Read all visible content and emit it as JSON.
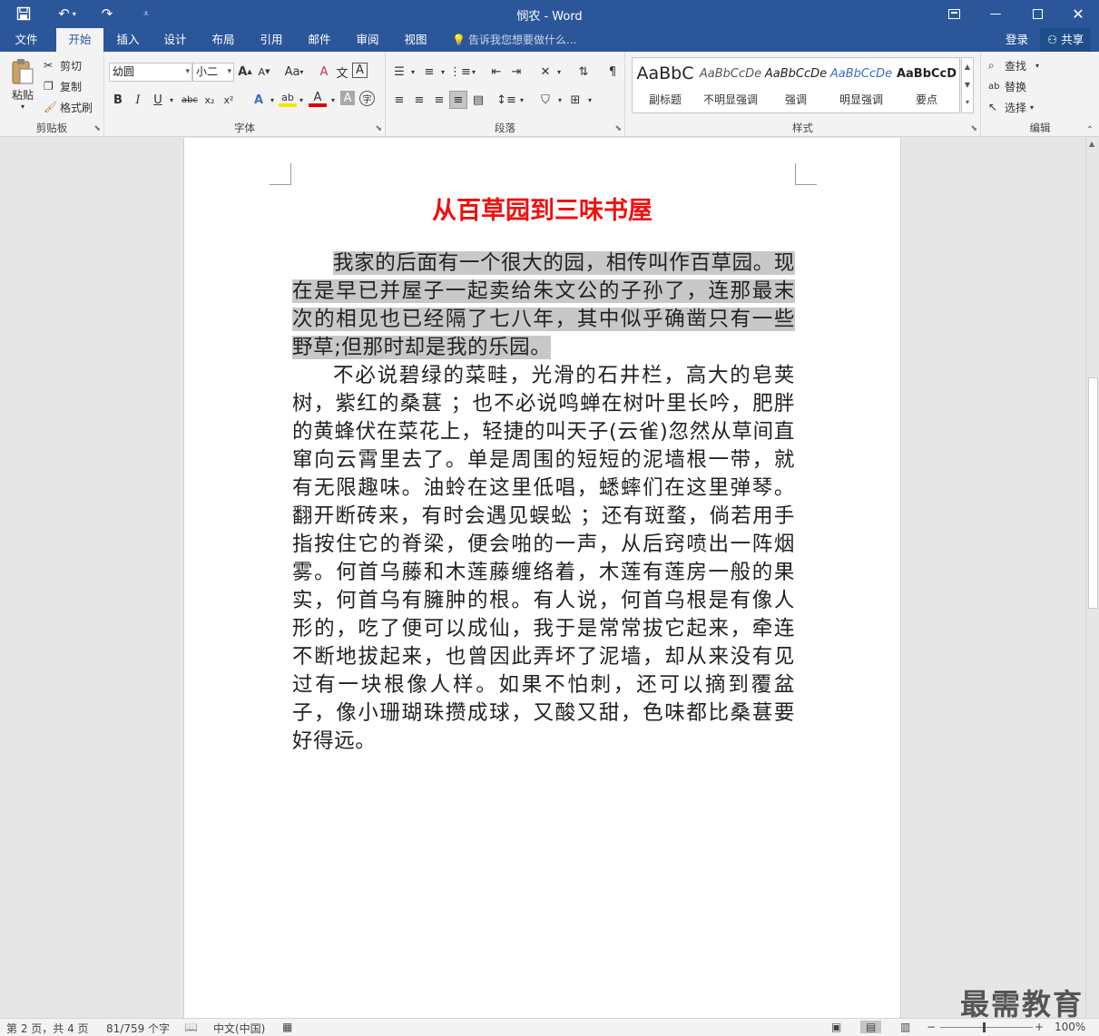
{
  "titlebar": {
    "title": "悯农 - Word",
    "save_icon": "save-icon",
    "undo_icon": "undo-icon",
    "redo_icon": "redo-icon",
    "customize_icon": "customize-qat-icon"
  },
  "menu": {
    "tabs": [
      "文件",
      "开始",
      "插入",
      "设计",
      "布局",
      "引用",
      "邮件",
      "审阅",
      "视图"
    ],
    "active": "开始",
    "tellme": "告诉我您想要做什么...",
    "login": "登录",
    "share": "共享"
  },
  "clipboard": {
    "paste": "粘贴",
    "cut": "剪切",
    "copy": "复制",
    "format_painter": "格式刷",
    "label": "剪贴板"
  },
  "font": {
    "name": "幼圆",
    "size": "小二",
    "label": "字体",
    "bold": "B",
    "italic": "I",
    "underline": "U",
    "strike": "abc",
    "sub": "x₂",
    "sup": "x²",
    "grow": "A",
    "shrink": "A",
    "case": "Aa",
    "clear": "A",
    "phonetic": "文",
    "charborder": "A",
    "texteffect": "A",
    "highlight": "ab",
    "fontcolor": "A",
    "charshade": "A",
    "encircle": "字"
  },
  "paragraph": {
    "label": "段落"
  },
  "styles": {
    "label": "样式",
    "items": [
      {
        "sample": "AaBbC",
        "name": "副标题"
      },
      {
        "sample": "AaBbCcDe",
        "name": "不明显强调"
      },
      {
        "sample": "AaBbCcDe",
        "name": "强调"
      },
      {
        "sample": "AaBbCcDe",
        "name": "明显强调"
      },
      {
        "sample": "AaBbCcD",
        "name": "要点"
      }
    ]
  },
  "editing": {
    "label": "编辑",
    "find": "查找",
    "replace": "替换",
    "select": "选择"
  },
  "document": {
    "title": "从百草园到三味书屋",
    "para1": "我家的后面有一个很大的园，相传叫作百草园。现在是早已并屋子一起卖给朱文公的子孙了，连那最末次的相见也已经隔了七八年，其中似乎确凿只有一些野草;但那时却是我的乐园。",
    "para2": "不必说碧绿的菜畦，光滑的石井栏，高大的皂荚树，紫红的桑葚 ；也不必说鸣蝉在树叶里长吟，肥胖的黄蜂伏在菜花上，轻捷的叫天子(云雀)忽然从草间直窜向云霄里去了。单是周围的短短的泥墙根一带，就有无限趣味。油蛉在这里低唱，蟋蟀们在这里弹琴。翻开断砖来，有时会遇见蜈蚣 ；还有斑蝥，倘若用手指按住它的脊梁，便会啪的一声，从后窍喷出一阵烟雾。何首乌藤和木莲藤缠络着，木莲有莲房一般的果实，何首乌有臃肿的根。有人说，何首乌根是有像人形的，吃了便可以成仙，我于是常常拔它起来，牵连不断地拔起来，也曾因此弄坏了泥墙，却从来没有见过有一块根像人样。如果不怕刺，还可以摘到覆盆子，像小珊瑚珠攒成球，又酸又甜，色味都比桑葚要好得远。"
  },
  "status": {
    "page": "第 2 页，共 4 页",
    "words": "81/759 个字",
    "language": "中文(中国)",
    "zoom": "100%"
  },
  "watermark": "最需教育",
  "colors": {
    "brand": "#2b579a",
    "title_red": "#ee1111",
    "highlight": "#c8c8c8"
  }
}
